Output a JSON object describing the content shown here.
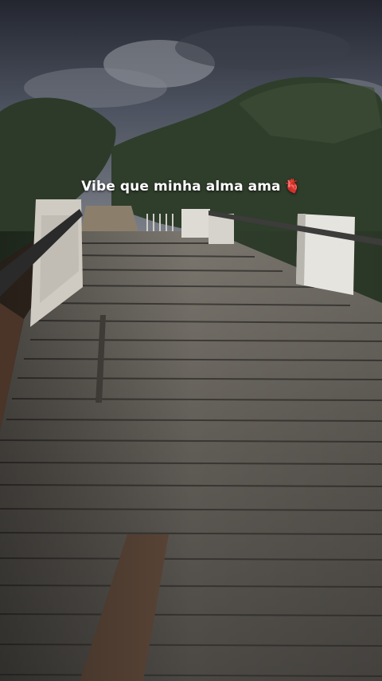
{
  "caption": {
    "text": "Vibe que minha alma ama",
    "emoji": "🫀",
    "emoji_name": "anatomical-heart-icon"
  },
  "scene": {
    "description_tags": [
      "wooden-bridge",
      "stormy-sky",
      "trees",
      "white-pillars",
      "railing"
    ],
    "colors": {
      "sky_dark": "#2a2f3c",
      "sky_mid": "#5b6270",
      "trees": "#2e3b2a",
      "planks": "#6e6a63",
      "planks_dark": "#3c3a37",
      "pillar": "#e4e2de"
    }
  }
}
